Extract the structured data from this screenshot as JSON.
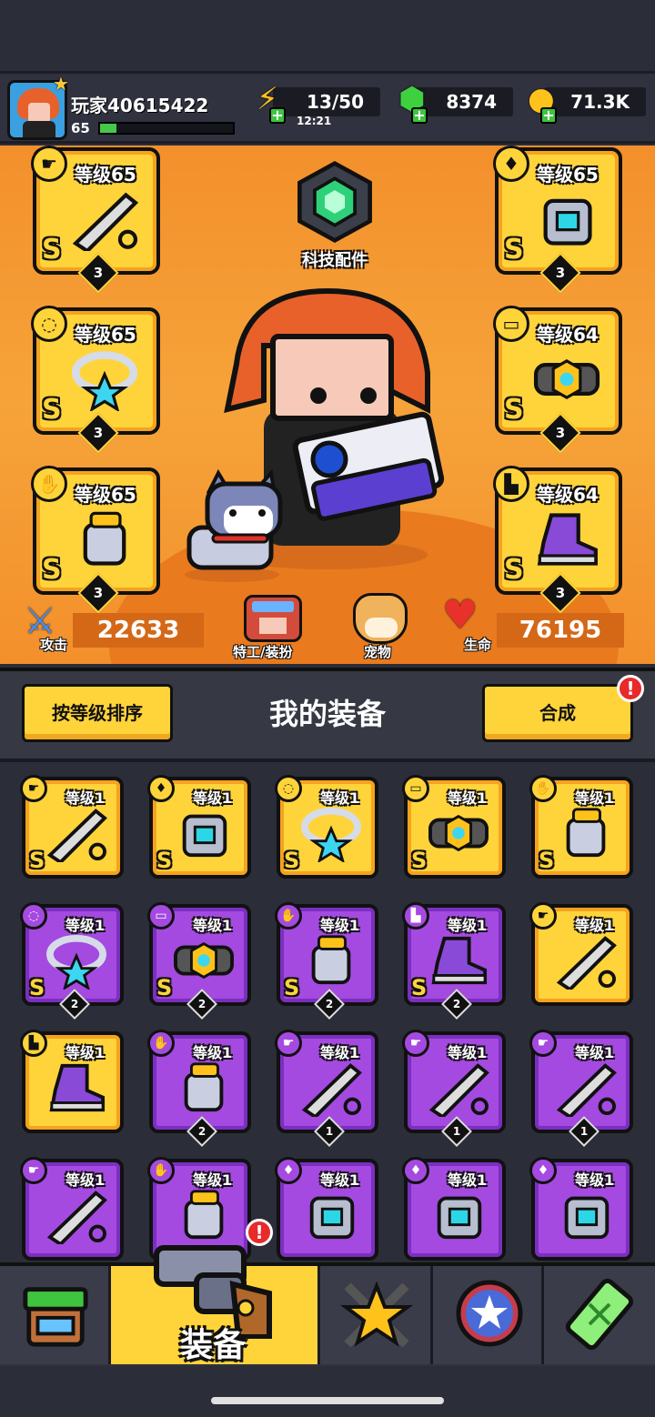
{
  "player": {
    "name": "玩家40615422",
    "level": "65",
    "xp_progress": 0.12
  },
  "resources": {
    "energy": "13/50",
    "energy_timer": "12:21",
    "gems": "8374",
    "coins": "71.3K"
  },
  "tech_parts_label": "科技配件",
  "equipped": [
    {
      "slot": "weapon",
      "level": "等级65",
      "grade": "S",
      "stars": "3"
    },
    {
      "slot": "armor",
      "level": "等级65",
      "grade": "S",
      "stars": "3"
    },
    {
      "slot": "necklace",
      "level": "等级65",
      "grade": "S",
      "stars": "3"
    },
    {
      "slot": "belt",
      "level": "等级64",
      "grade": "S",
      "stars": "3"
    },
    {
      "slot": "gloves",
      "level": "等级65",
      "grade": "S",
      "stars": "3"
    },
    {
      "slot": "boots",
      "level": "等级64",
      "grade": "S",
      "stars": "3"
    }
  ],
  "stats": {
    "attack_label": "攻击",
    "attack_value": "22633",
    "agent_label": "特工/装扮",
    "pet_label": "宠物",
    "hp_label": "生命",
    "hp_value": "76195"
  },
  "equipment_panel": {
    "sort_button": "按等级排序",
    "title": "我的装备",
    "merge_button": "合成",
    "merge_alert": "!"
  },
  "inventory": [
    {
      "type": "weapon",
      "rarity": "gold",
      "level": "等级1",
      "grade": "S",
      "stars": ""
    },
    {
      "type": "armor",
      "rarity": "gold",
      "level": "等级1",
      "grade": "S",
      "stars": ""
    },
    {
      "type": "necklace",
      "rarity": "gold",
      "level": "等级1",
      "grade": "S",
      "stars": ""
    },
    {
      "type": "belt",
      "rarity": "gold",
      "level": "等级1",
      "grade": "S",
      "stars": ""
    },
    {
      "type": "gloves",
      "rarity": "gold",
      "level": "等级1",
      "grade": "S",
      "stars": ""
    },
    {
      "type": "necklace",
      "rarity": "purple",
      "level": "等级1",
      "grade": "S",
      "stars": "2"
    },
    {
      "type": "belt",
      "rarity": "purple",
      "level": "等级1",
      "grade": "S",
      "stars": "2"
    },
    {
      "type": "gloves",
      "rarity": "purple",
      "level": "等级1",
      "grade": "S",
      "stars": "2"
    },
    {
      "type": "boots",
      "rarity": "purple",
      "level": "等级1",
      "grade": "S",
      "stars": "2"
    },
    {
      "type": "weapon",
      "rarity": "gold",
      "level": "等级1",
      "grade": "",
      "stars": ""
    },
    {
      "type": "boots",
      "rarity": "gold",
      "level": "等级1",
      "grade": "",
      "stars": ""
    },
    {
      "type": "gloves",
      "rarity": "purple",
      "level": "等级1",
      "grade": "",
      "stars": "2"
    },
    {
      "type": "weapon",
      "rarity": "purple",
      "level": "等级1",
      "grade": "",
      "stars": "1"
    },
    {
      "type": "weapon",
      "rarity": "purple",
      "level": "等级1",
      "grade": "",
      "stars": "1"
    },
    {
      "type": "weapon",
      "rarity": "purple",
      "level": "等级1",
      "grade": "",
      "stars": "1"
    },
    {
      "type": "weapon",
      "rarity": "purple",
      "level": "等级1",
      "grade": "",
      "stars": ""
    },
    {
      "type": "gloves",
      "rarity": "purple",
      "level": "等级1",
      "grade": "",
      "stars": ""
    },
    {
      "type": "armor",
      "rarity": "purple",
      "level": "等级1",
      "grade": "",
      "stars": ""
    },
    {
      "type": "armor",
      "rarity": "purple",
      "level": "等级1",
      "grade": "",
      "stars": ""
    },
    {
      "type": "armor",
      "rarity": "purple",
      "level": "等级1",
      "grade": "",
      "stars": ""
    }
  ],
  "nav": {
    "active_label": "装备",
    "active_alert": "!",
    "tabs": [
      "shop-icon",
      "equipment-icon",
      "talent-icon",
      "skills-icon",
      "evolve-icon"
    ]
  },
  "icons": {
    "weapon": "☛",
    "armor": "♦",
    "necklace": "◌",
    "belt": "▭",
    "gloves": "✋",
    "boots": "▙",
    "energy": "⚡",
    "gem": "⬢",
    "coin": "●",
    "attack": "⚔",
    "heart": "♥"
  },
  "colors": {
    "gold_card": "#ffd43a",
    "purple_card": "#a44ae0",
    "hero_bg": "#f3902c"
  }
}
